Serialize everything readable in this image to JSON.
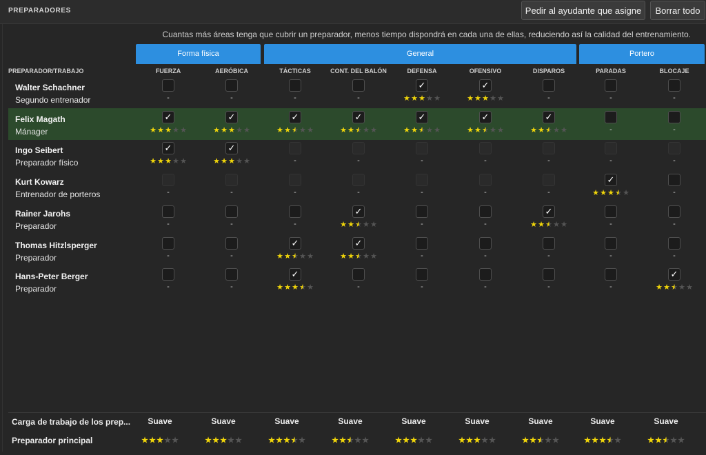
{
  "header": {
    "title": "PREPARADORES",
    "assign_label": "Pedir al ayudante que asigne",
    "clear_label": "Borrar todo"
  },
  "description": "Cuantas más áreas tenga que cubrir un preparador, menos tiempo dispondrá en cada una de ellas, reduciendo así la calidad del entrenamiento.",
  "groups": [
    "Forma física",
    "General",
    "Portero"
  ],
  "row_header": "PREPARADOR/TRABAJO",
  "columns": [
    "FUERZA",
    "AERÓBICA",
    "TÁCTICAS",
    "CONT. DEL BALÓN",
    "DEFENSA",
    "OFENSIVO",
    "DISPAROS",
    "PARADAS",
    "BLOCAJE"
  ],
  "dash": "-",
  "coaches": [
    {
      "name": "Walter Schachner",
      "role": "Segundo entrenador",
      "highlight": false,
      "cells": [
        {
          "s": "o"
        },
        {
          "s": "o"
        },
        {
          "s": "o"
        },
        {
          "s": "o"
        },
        {
          "s": "c",
          "r": 3
        },
        {
          "s": "c",
          "r": 3
        },
        {
          "s": "o"
        },
        {
          "s": "o"
        },
        {
          "s": "o"
        }
      ]
    },
    {
      "name": "Felix Magath",
      "role": "Mánager",
      "highlight": true,
      "cells": [
        {
          "s": "c",
          "r": 3
        },
        {
          "s": "c",
          "r": 3
        },
        {
          "s": "c",
          "r": 2.5
        },
        {
          "s": "c",
          "r": 2.5
        },
        {
          "s": "c",
          "r": 2.5
        },
        {
          "s": "c",
          "r": 2.5
        },
        {
          "s": "c",
          "r": 2.5
        },
        {
          "s": "o"
        },
        {
          "s": "o"
        }
      ]
    },
    {
      "name": "Ingo Seibert",
      "role": "Preparador físico",
      "highlight": false,
      "cells": [
        {
          "s": "c",
          "r": 3
        },
        {
          "s": "c",
          "r": 3
        },
        {
          "s": "d"
        },
        {
          "s": "d"
        },
        {
          "s": "d"
        },
        {
          "s": "d"
        },
        {
          "s": "d"
        },
        {
          "s": "d"
        },
        {
          "s": "d"
        }
      ]
    },
    {
      "name": "Kurt Kowarz",
      "role": "Entrenador de porteros",
      "highlight": false,
      "cells": [
        {
          "s": "d"
        },
        {
          "s": "d"
        },
        {
          "s": "d"
        },
        {
          "s": "d"
        },
        {
          "s": "d"
        },
        {
          "s": "d"
        },
        {
          "s": "d"
        },
        {
          "s": "c",
          "r": 3.5
        },
        {
          "s": "o"
        }
      ]
    },
    {
      "name": "Rainer Jarohs",
      "role": "Preparador",
      "highlight": false,
      "cells": [
        {
          "s": "o"
        },
        {
          "s": "o"
        },
        {
          "s": "o"
        },
        {
          "s": "c",
          "r": 2.5
        },
        {
          "s": "o"
        },
        {
          "s": "o"
        },
        {
          "s": "c",
          "r": 2.5
        },
        {
          "s": "o"
        },
        {
          "s": "o"
        }
      ]
    },
    {
      "name": "Thomas Hitzlsperger",
      "role": "Preparador",
      "highlight": false,
      "cells": [
        {
          "s": "o"
        },
        {
          "s": "o"
        },
        {
          "s": "c",
          "r": 2.5
        },
        {
          "s": "c",
          "r": 2.5
        },
        {
          "s": "o"
        },
        {
          "s": "o"
        },
        {
          "s": "o"
        },
        {
          "s": "o"
        },
        {
          "s": "o"
        }
      ]
    },
    {
      "name": "Hans-Peter Berger",
      "role": "Preparador",
      "highlight": false,
      "cells": [
        {
          "s": "o"
        },
        {
          "s": "o"
        },
        {
          "s": "c",
          "r": 3.5
        },
        {
          "s": "o"
        },
        {
          "s": "o"
        },
        {
          "s": "o"
        },
        {
          "s": "o"
        },
        {
          "s": "o"
        },
        {
          "s": "c",
          "r": 2.5
        }
      ]
    }
  ],
  "footer": {
    "workload_label": "Carga de trabajo de los prep...",
    "workload": [
      "Suave",
      "Suave",
      "Suave",
      "Suave",
      "Suave",
      "Suave",
      "Suave",
      "Suave",
      "Suave"
    ],
    "main_label": "Preparador principal",
    "main_ratings": [
      3,
      3,
      3.5,
      2.5,
      3,
      3,
      2.5,
      3.5,
      2.5
    ]
  },
  "colors": {
    "accent": "#2d8fe0",
    "highlight_row": "#2c4a2c",
    "star": "#f1d60a"
  },
  "icons": {
    "check": "check-icon",
    "star": "star-icon"
  }
}
